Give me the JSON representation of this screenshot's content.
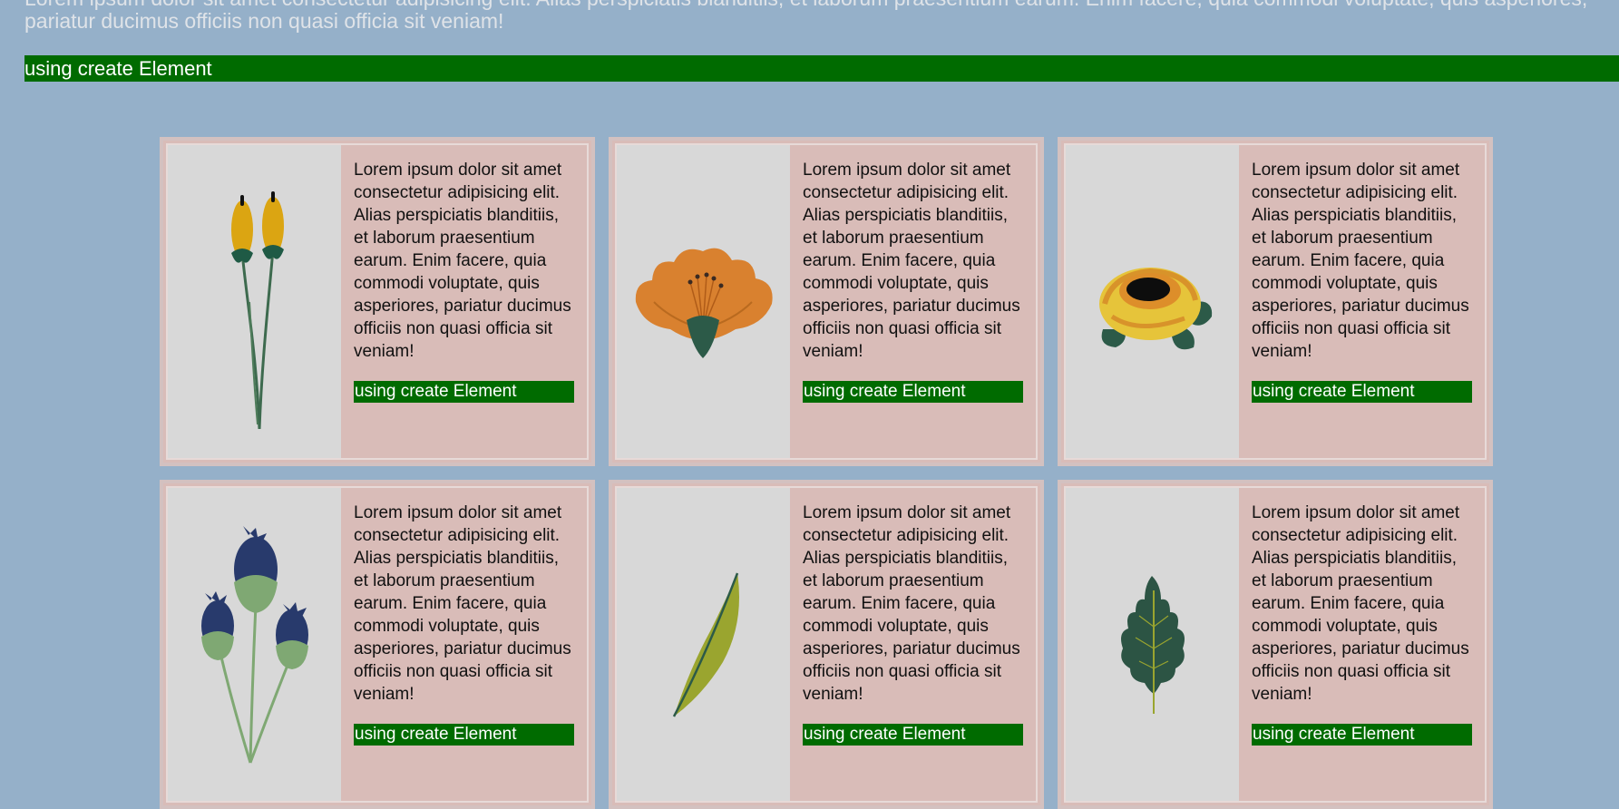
{
  "intro": {
    "text": "Lorem ipsum dolor sit amet consectetur adipisicing elit. Alias perspiciatis blanditiis, et laborum praesentium earum. Enim facere, quia commodi voluptate, quis asperiores, pariatur ducimus officiis non quasi officia sit veniam!"
  },
  "banner": {
    "label": "using create Element"
  },
  "colors": {
    "page_background": "#95b0c9",
    "banner_background": "#006b00",
    "card_background": "#d9bcb8",
    "image_panel_background": "#d8d8d8"
  },
  "cards": [
    {
      "icon": "cattail-flower-icon",
      "text": "Lorem ipsum dolor sit amet consectetur adipisicing elit. Alias perspiciatis blanditiis, et laborum praesentium earum. Enim facere, quia commodi voluptate, quis asperiores, pariatur ducimus officiis non quasi officia sit veniam!",
      "tag": "using create Element"
    },
    {
      "icon": "orange-flower-icon",
      "text": "Lorem ipsum dolor sit amet consectetur adipisicing elit. Alias perspiciatis blanditiis, et laborum praesentium earum. Enim facere, quia commodi voluptate, quis asperiores, pariatur ducimus officiis non quasi officia sit veniam!",
      "tag": "using create Element"
    },
    {
      "icon": "yellow-rose-icon",
      "text": "Lorem ipsum dolor sit amet consectetur adipisicing elit. Alias perspiciatis blanditiis, et laborum praesentium earum. Enim facere, quia commodi voluptate, quis asperiores, pariatur ducimus officiis non quasi officia sit veniam!",
      "tag": "using create Element"
    },
    {
      "icon": "blue-thistle-icon",
      "text": "Lorem ipsum dolor sit amet consectetur adipisicing elit. Alias perspiciatis blanditiis, et laborum praesentium earum. Enim facere, quia commodi voluptate, quis asperiores, pariatur ducimus officiis non quasi officia sit veniam!",
      "tag": "using create Element"
    },
    {
      "icon": "olive-leaf-icon",
      "text": "Lorem ipsum dolor sit amet consectetur adipisicing elit. Alias perspiciatis blanditiis, et laborum praesentium earum. Enim facere, quia commodi voluptate, quis asperiores, pariatur ducimus officiis non quasi officia sit veniam!",
      "tag": "using create Element"
    },
    {
      "icon": "oak-leaf-icon",
      "text": "Lorem ipsum dolor sit amet consectetur adipisicing elit. Alias perspiciatis blanditiis, et laborum praesentium earum. Enim facere, quia commodi voluptate, quis asperiores, pariatur ducimus officiis non quasi officia sit veniam!",
      "tag": "using create Element"
    }
  ]
}
